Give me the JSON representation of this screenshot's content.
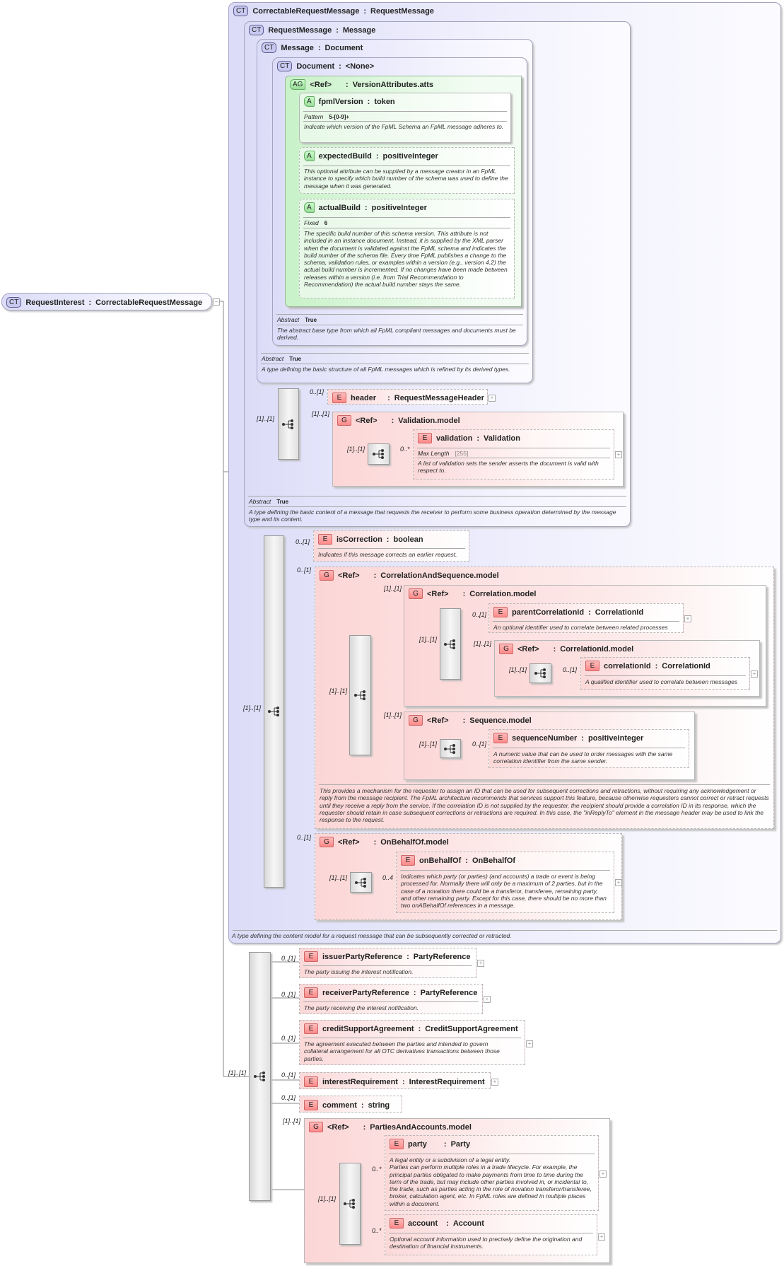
{
  "root": {
    "badge": "CT",
    "name": "RequestInterest",
    "type": "CorrectableRequestMessage"
  },
  "correctable": {
    "badge": "CT",
    "name": "CorrectableRequestMessage",
    "type": "RequestMessage",
    "doc": "A type defining the content model for a request message that can be subsequently corrected or retracted."
  },
  "requestMessage": {
    "badge": "CT",
    "name": "RequestMessage",
    "type": "Message",
    "abstract_label": "Abstract",
    "abstract_value": "True",
    "doc": "A type defining the basic content of a message that requests the receiver to perform some business operation determined by the message type and its content."
  },
  "message": {
    "badge": "CT",
    "name": "Message",
    "type": "Document",
    "abstract_label": "Abstract",
    "abstract_value": "True",
    "doc": "A type defining the basic structure of all FpML messages which is refined by its derived types."
  },
  "document": {
    "badge": "CT",
    "name": "Document",
    "type": "<None>",
    "abstract_label": "Abstract",
    "abstract_value": "True",
    "doc": "The abstract base type from which all FpML compliant messages and documents must be derived."
  },
  "versionAtts": {
    "badge": "AG",
    "ref": "<Ref>",
    "type": "VersionAttributes.atts"
  },
  "fpmlVersion": {
    "badge": "A",
    "name": "fpmlVersion",
    "type": "token",
    "facet_label": "Pattern",
    "facet_value": "5-[0-9]+",
    "doc": "Indicate which version of the FpML Schema an FpML message adheres to."
  },
  "expectedBuild": {
    "badge": "A",
    "name": "expectedBuild",
    "type": "positiveInteger",
    "doc": "This optional attribute can be supplied by a message creator in an FpML instance to specify which build number of the schema was used to define the message when it was generated."
  },
  "actualBuild": {
    "badge": "A",
    "name": "actualBuild",
    "type": "positiveInteger",
    "facet_label": "Fixed",
    "facet_value": "6",
    "doc": "The specific build number of this schema version. This attribute is not included in an instance document. Instead, it is supplied by the XML parser when the document is validated against the FpML schema and indicates the build number of the schema file. Every time FpML publishes a change to the schema, validation rules, or examples within a version (e.g., version 4.2) the actual build number is incremented. If no changes have been made between releases within a version (i.e. from Trial Recommendation to Recommendation) the actual build number stays the same."
  },
  "header": {
    "badge": "E",
    "name": "header",
    "type": "RequestMessageHeader",
    "mult": "0..[1]"
  },
  "validationModel": {
    "badge": "G",
    "ref": "<Ref>",
    "type": "Validation.model",
    "mult": "[1]..[1]",
    "seq_mult": "[1]..[1]"
  },
  "validation": {
    "badge": "E",
    "name": "validation",
    "type": "Validation",
    "mult": "0..*",
    "facet_label": "Max Length",
    "facet_value": "[255]",
    "doc": "A list of validation sets the sender asserts the document is valid with respect to."
  },
  "reqSeqMult": "[1]..[1]",
  "corrSeqMult": "[1]..[1]",
  "isCorrection": {
    "badge": "E",
    "name": "isCorrection",
    "type": "boolean",
    "mult": "0..[1]",
    "doc": "Indicates if this message corrects an earlier request."
  },
  "corrAndSeq": {
    "badge": "G",
    "ref": "<Ref>",
    "type": "CorrelationAndSequence.model",
    "mult": "0..[1]",
    "seq_mult": "[1]..[1]",
    "doc": "This provides a mechanism for the requester to assign an ID that can be used for subsequent corrections and retractions, without requiring any acknowledgement or reply from the message recipient. The FpML architecture recommends that services support this feature, because otherwise requesters cannot correct or retract requests until they receive a reply from the service. If the correlation ID is not supplied by the requester, the recipient should provide a correlation ID in its response, which the requester should retain in case subsequent corrections or retractions are required. In this case, the \"inReplyTo\" element in the message header may be used to link the response to the request."
  },
  "correlationModel": {
    "badge": "G",
    "ref": "<Ref>",
    "type": "Correlation.model",
    "mult": "[1]..[1]",
    "seq_mult": "[1]..[1]"
  },
  "parentCorrelationId": {
    "badge": "E",
    "name": "parentCorrelationId",
    "type": "CorrelationId",
    "mult": "0..[1]",
    "doc": "An optional identifier used to correlate between related processes"
  },
  "correlationIdModel": {
    "badge": "G",
    "ref": "<Ref>",
    "type": "CorrelationId.model",
    "mult": "[1]..[1]",
    "seq_mult": "[1]..[1]"
  },
  "correlationId": {
    "badge": "E",
    "name": "correlationId",
    "type": "CorrelationId",
    "mult": "0..[1]",
    "doc": "A qualified identifier used to correlate between messages"
  },
  "sequenceModel": {
    "badge": "G",
    "ref": "<Ref>",
    "type": "Sequence.model",
    "mult": "[1]..[1]",
    "seq_mult": "[1]..[1]"
  },
  "sequenceNumber": {
    "badge": "E",
    "name": "sequenceNumber",
    "type": "positiveInteger",
    "mult": "0..[1]",
    "doc": "A numeric value that can be used to order messages with the same correlation identifier from the same sender."
  },
  "onBehalfOfModel": {
    "badge": "G",
    "ref": "<Ref>",
    "type": "OnBehalfOf.model",
    "mult": "0..[1]",
    "seq_mult": "[1]..[1]"
  },
  "onBehalfOf": {
    "badge": "E",
    "name": "onBehalfOf",
    "type": "OnBehalfOf",
    "mult": "0..4",
    "doc": "Indicates which party (or parties) (and accounts) a trade or event is being processed for. Normally there will only be a maximum of 2 parties, but in the case of a novation there could be a transferor, transferee, remaining party, and other remaining party. Except for this case, there should be no more than two onABehalfOf references in a message."
  },
  "mainSeqMult": "[1]..[1]",
  "issuerPartyReference": {
    "badge": "E",
    "name": "issuerPartyReference",
    "type": "PartyReference",
    "mult": "0..[1]",
    "doc": "The party issuing the interest notification."
  },
  "receiverPartyReference": {
    "badge": "E",
    "name": "receiverPartyReference",
    "type": "PartyReference",
    "mult": "0..[1]",
    "doc": "The party receiving the interest notification."
  },
  "creditSupportAgreement": {
    "badge": "E",
    "name": "creditSupportAgreement",
    "type": "CreditSupportAgreement",
    "mult": "0..[1]",
    "doc": "The agreement executed between the parties and intended to govern collateral arrangement for all OTC derivatives transactions between those parties."
  },
  "interestRequirement": {
    "badge": "E",
    "name": "interestRequirement",
    "type": "InterestRequirement",
    "mult": "0..[1]"
  },
  "comment": {
    "badge": "E",
    "name": "comment",
    "type": "string",
    "mult": "0..[1]"
  },
  "partiesModel": {
    "badge": "G",
    "ref": "<Ref>",
    "type": "PartiesAndAccounts.model",
    "mult": "[1]..[1]",
    "seq_mult": "[1]..[1]"
  },
  "party": {
    "badge": "E",
    "name": "party",
    "type": "Party",
    "mult": "0..*",
    "doc": "A legal entity or a subdivision of a legal entity.\nParties can perform multiple roles in a trade lifecycle. For example, the principal parties obligated to make payments from time to time during the term of the trade, but may include other parties involved in, or incidental to, the trade, such as parties acting in the role of novation transferor/transferee, broker, calculation agent, etc. In FpML roles are defined in multiple places within a document."
  },
  "account": {
    "badge": "E",
    "name": "account",
    "type": "Account",
    "mult": "0..*",
    "doc": "Optional account information used to precisely define the origination and destination of financial instruments."
  },
  "sep": ":",
  "expand": "+"
}
